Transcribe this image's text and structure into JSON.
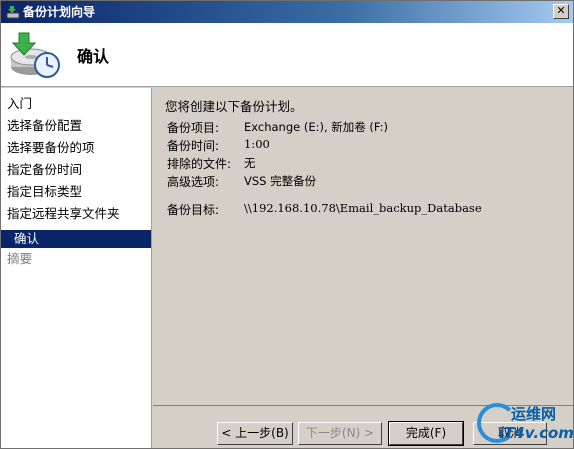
{
  "window": {
    "title": "备份计划向导",
    "close_glyph": "✕"
  },
  "header": {
    "title": "确认",
    "icon": "backup-wizard-icon"
  },
  "nav": {
    "items": [
      {
        "label": "入门",
        "state": "normal"
      },
      {
        "label": "选择备份配置",
        "state": "normal"
      },
      {
        "label": "选择要备份的项",
        "state": "normal"
      },
      {
        "label": "指定备份时间",
        "state": "normal"
      },
      {
        "label": "指定目标类型",
        "state": "normal"
      },
      {
        "label": "指定远程共享文件夹",
        "state": "normal"
      },
      {
        "label": "确认",
        "state": "active"
      },
      {
        "label": "摘要",
        "state": "dim"
      }
    ]
  },
  "content": {
    "intro": "您将创建以下备份计划。",
    "rows": [
      {
        "label": "备份项目:",
        "value": "Exchange (E:), 新加卷 (F:)"
      },
      {
        "label": "备份时间:",
        "value": "1:00"
      },
      {
        "label": "排除的文件:",
        "value": "无"
      },
      {
        "label": "高级选项:",
        "value": "VSS 完整备份"
      },
      {
        "label": "备份目标:",
        "value": "\\\\192.168.10.78\\Email_backup_Database"
      }
    ]
  },
  "buttons": {
    "back": "< 上一步(B)",
    "next": "下一步(N) >",
    "finish": "完成(F)",
    "cancel": "取消"
  },
  "watermark": {
    "line1": "运维网",
    "line2": "iT4v.com"
  },
  "colors": {
    "selection": "#0a246a",
    "titlebar": "#0a246a",
    "dialog_face": "#d4d0c8"
  }
}
